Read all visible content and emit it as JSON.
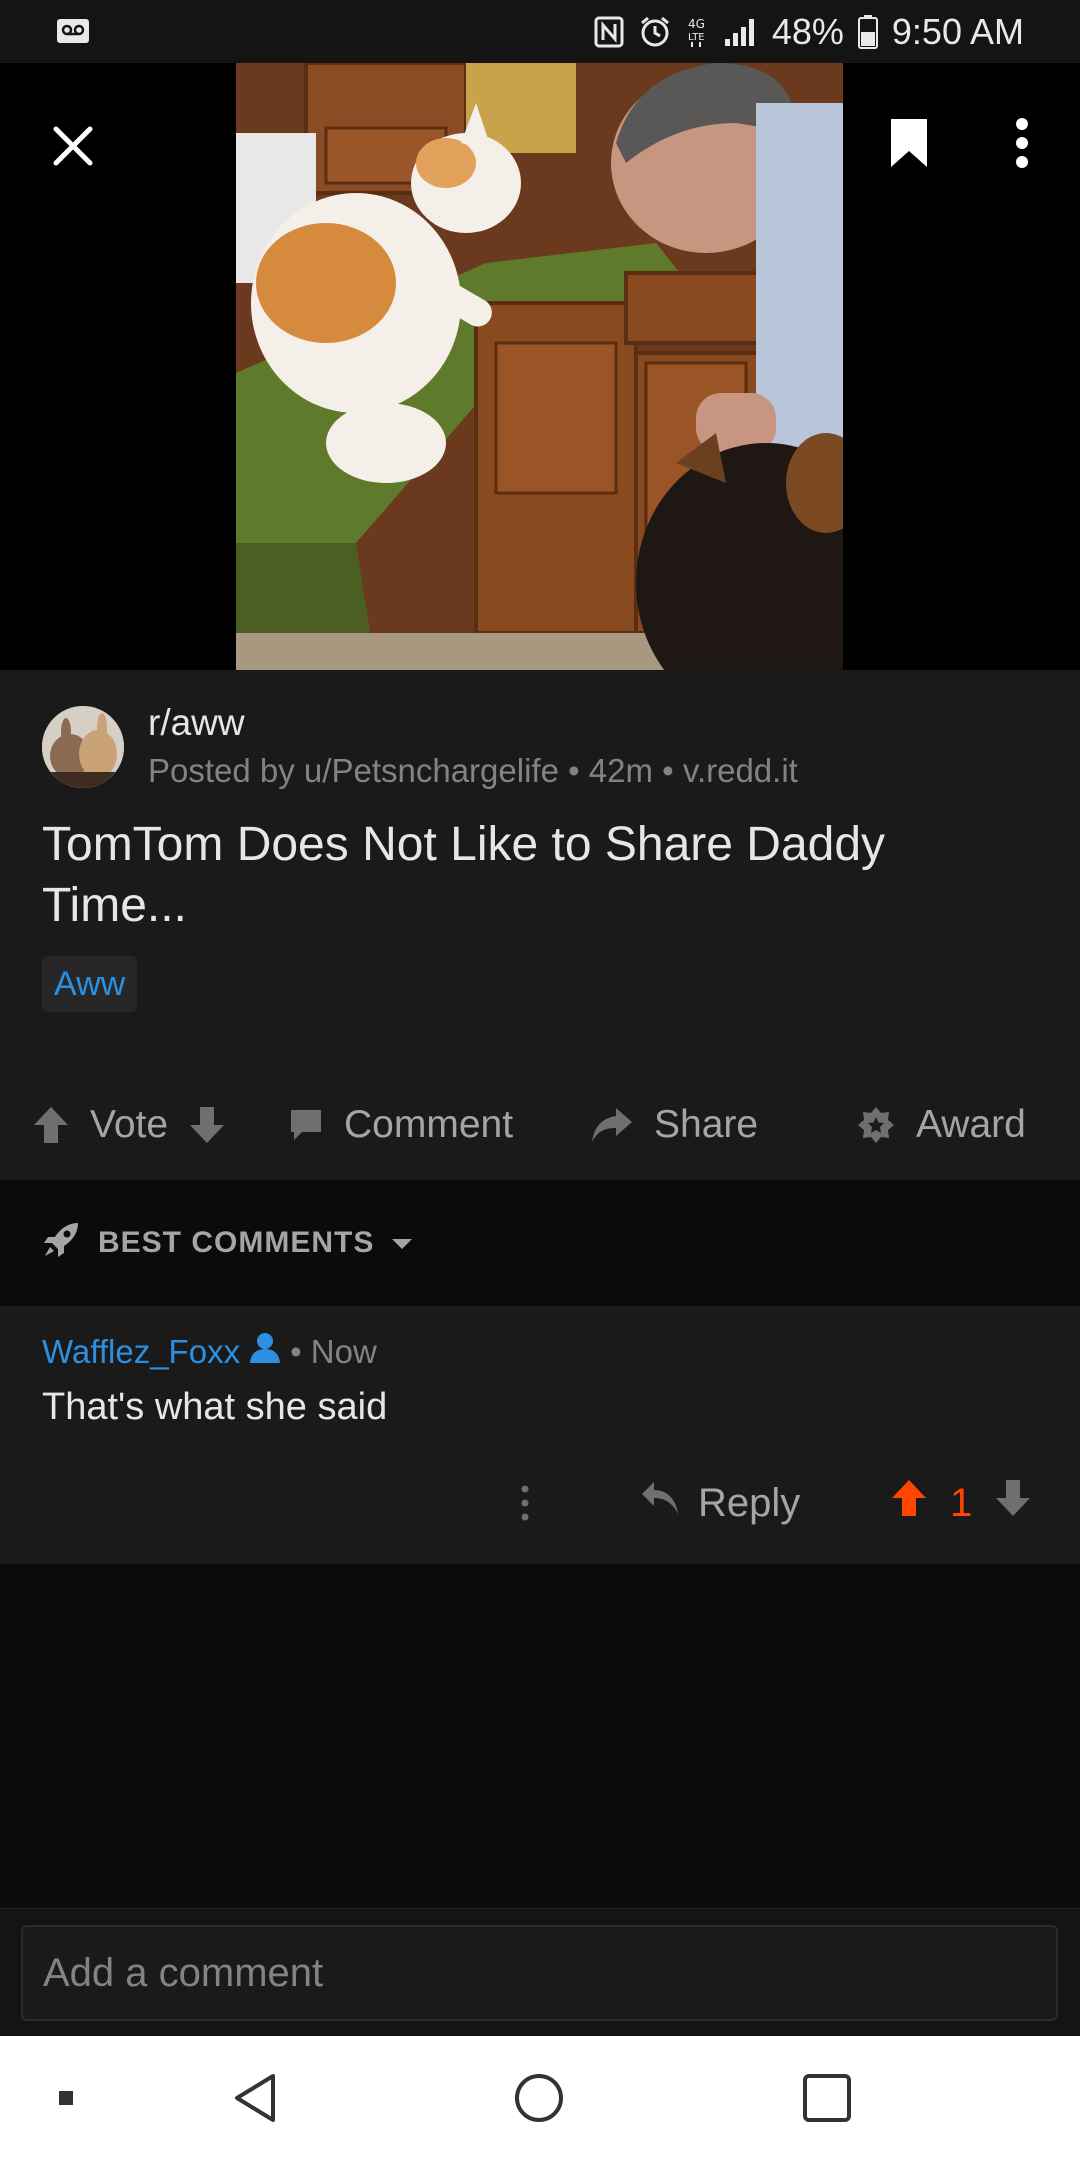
{
  "status_bar": {
    "battery": "48%",
    "time": "9:50 AM",
    "icons": [
      "voicemail-icon",
      "nfc-icon",
      "alarm-icon",
      "lte-icon",
      "signal-icon",
      "battery-icon"
    ]
  },
  "video": {
    "close_icon": "close-icon",
    "save_icon": "bookmark-icon",
    "more_icon": "more-vertical-icon"
  },
  "post": {
    "subreddit": "r/aww",
    "meta": "Posted by u/Petsnchargelife • 42m • v.redd.it",
    "title": "TomTom Does Not Like to Share Daddy Time...",
    "flair": "Aww"
  },
  "actions": {
    "vote": "Vote",
    "comment": "Comment",
    "share": "Share",
    "award": "Award"
  },
  "sort": {
    "label": "BEST COMMENTS"
  },
  "comment": {
    "author": "Wafflez_Foxx",
    "time": "• Now",
    "body": "That's what she said",
    "reply": "Reply",
    "score": "1"
  },
  "add_comment": {
    "placeholder": "Add a comment"
  },
  "colors": {
    "accent_blue": "#2d8fe0",
    "upvote_orange": "#ff4500",
    "background": "#0b0b0c",
    "card": "#1a1a1b"
  }
}
